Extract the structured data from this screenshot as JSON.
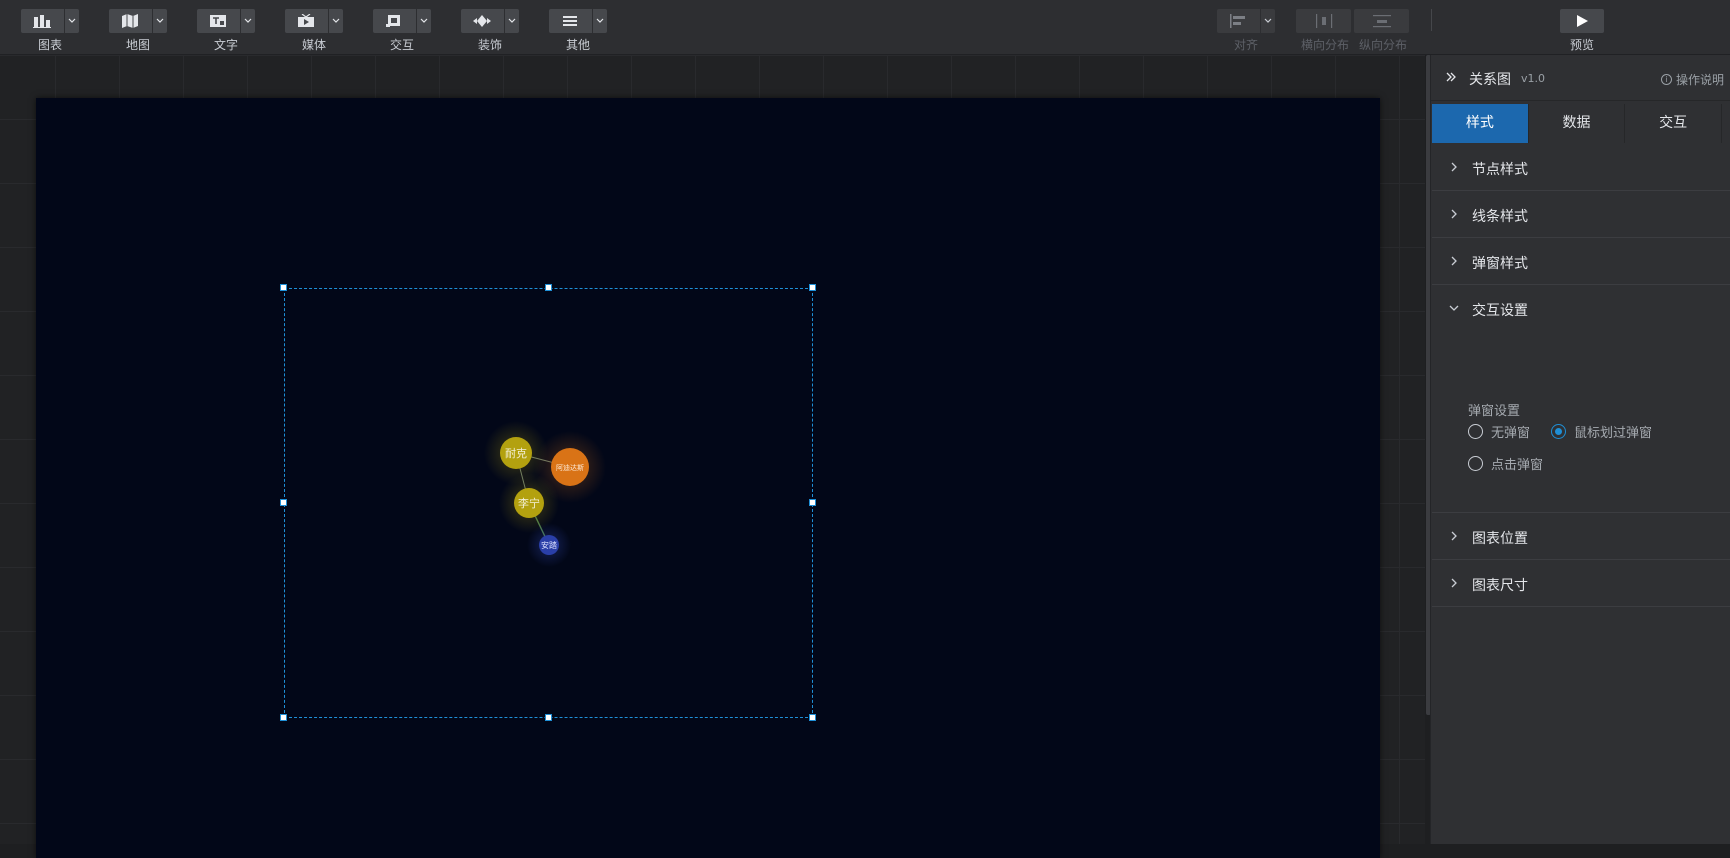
{
  "toolbar": {
    "tools": [
      {
        "label": "图表",
        "icon": "chart-icon"
      },
      {
        "label": "地图",
        "icon": "map-icon"
      },
      {
        "label": "文字",
        "icon": "text-icon"
      },
      {
        "label": "媒体",
        "icon": "media-icon"
      },
      {
        "label": "交互",
        "icon": "interaction-icon"
      },
      {
        "label": "装饰",
        "icon": "decoration-icon"
      },
      {
        "label": "其他",
        "icon": "other-icon"
      }
    ],
    "align": {
      "label": "对齐",
      "icon": "align-left-icon"
    },
    "h_distribute": {
      "label": "横向分布",
      "icon": "distribute-horizontal-icon"
    },
    "v_distribute": {
      "label": "纵向分布",
      "icon": "distribute-vertical-icon"
    },
    "preview": {
      "label": "预览",
      "icon": "play-icon"
    }
  },
  "graph": {
    "nodes": [
      {
        "name": "耐克",
        "color": "#b3a10f"
      },
      {
        "name": "阿迪达斯",
        "color": "#d97316"
      },
      {
        "name": "李宁",
        "color": "#b3a10f"
      },
      {
        "name": "安踏",
        "color": "#2a3fa8"
      }
    ]
  },
  "panel": {
    "title": "关系图",
    "version": "v1.0",
    "help": "操作说明",
    "tabs": [
      "样式",
      "数据",
      "交互"
    ],
    "active_tab": "样式",
    "sections": {
      "node_style": "节点样式",
      "line_style": "线条样式",
      "popup_style": "弹窗样式",
      "interaction": "交互设置",
      "chart_position": "图表位置",
      "chart_size": "图表尺寸"
    },
    "popup_settings": {
      "label": "弹窗设置",
      "options": [
        "无弹窗",
        "鼠标划过弹窗",
        "点击弹窗"
      ],
      "selected": "鼠标划过弹窗"
    }
  },
  "colors": {
    "accent": "#1f8fd6",
    "tab_active": "#1c68ae",
    "board": "#020718"
  }
}
